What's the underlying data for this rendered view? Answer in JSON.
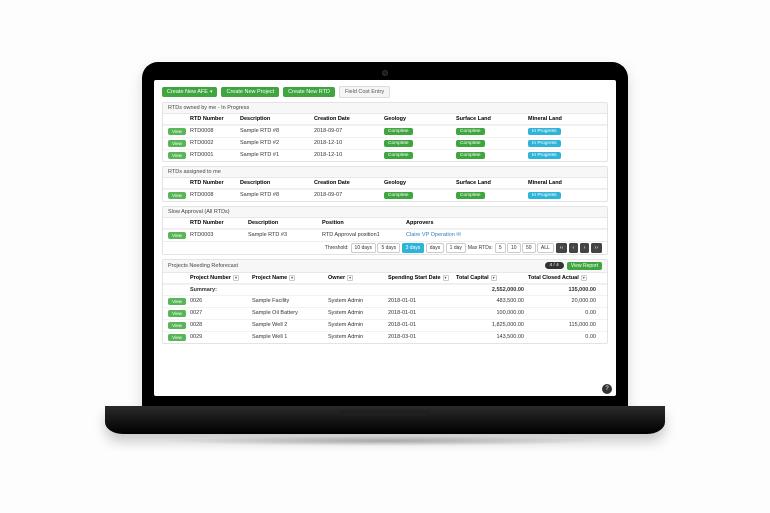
{
  "toolbar": {
    "create_afe": "Create New AFE",
    "create_project": "Create New Project",
    "create_rtd": "Create New RTD",
    "field_cost_entry": "Field Cost Entry"
  },
  "colors": {
    "green": "#3fa63f",
    "cyan": "#2fb4d9",
    "dark": "#333"
  },
  "labels": {
    "view": "View",
    "complete": "Complete",
    "in_progress": "In Progress"
  },
  "sections": {
    "owned": {
      "title": "RTDs owned by me - In Progress",
      "headers": [
        "RTD Number",
        "Description",
        "Creation Date",
        "Geology",
        "Surface Land",
        "Mineral Land"
      ],
      "rows": [
        {
          "num": "RTD0008",
          "desc": "Sample RTD #8",
          "date": "2018-09-07",
          "geo": "Complete",
          "surf": "Complete",
          "mineral": "In Progress"
        },
        {
          "num": "RTD0002",
          "desc": "Sample RTD #2",
          "date": "2018-12-10",
          "geo": "Complete",
          "surf": "Complete",
          "mineral": "In Progress"
        },
        {
          "num": "RTD0001",
          "desc": "Sample RTD #1",
          "date": "2018-12-10",
          "geo": "Complete",
          "surf": "Complete",
          "mineral": "In Progress"
        }
      ]
    },
    "assigned": {
      "title": "RTDs assigned to me",
      "headers": [
        "RTD Number",
        "Description",
        "Creation Date",
        "Geology",
        "Surface Land",
        "Mineral Land"
      ],
      "rows": [
        {
          "num": "RTD0008",
          "desc": "Sample RTD #8",
          "date": "2018-09-07",
          "geo": "Complete",
          "surf": "Complete",
          "mineral": "In Progress"
        }
      ]
    },
    "slow": {
      "title": "Slow Approval (All RTDs)",
      "headers": [
        "RTD Number",
        "Description",
        "Position",
        "Approvers"
      ],
      "rows": [
        {
          "num": "RTD0003",
          "desc": "Sample RTD #3",
          "pos": "RTD Approval position1",
          "appr": "Claire VP Operation"
        }
      ],
      "filters": {
        "threshold_label": "Threshold:",
        "opts": [
          "10 days",
          "5 days",
          "3 days",
          "days",
          "1 day"
        ],
        "selected": "3 days",
        "max_label": "Max RTDs:",
        "max_opts": [
          "5",
          "10",
          "50",
          "ALL"
        ],
        "chevrons": [
          "‹‹",
          "‹",
          "›",
          "››"
        ]
      }
    },
    "reforecast": {
      "title": "Projects Needing Reforecast",
      "badge": "4 / 4",
      "view_report": "View Report",
      "headers": [
        "Project Number",
        "Project Name",
        "Owner",
        "Spending Start Date",
        "Total Capital",
        "Total Closed Actual"
      ],
      "summary_label": "Summary:",
      "summary": {
        "capital": "2,552,000.00",
        "closed": "135,000.00"
      },
      "rows": [
        {
          "num": "0026",
          "name": "Sample Facility",
          "owner": "System Admin",
          "date": "2018-01-01",
          "capital": "483,500.00",
          "closed": "20,000.00"
        },
        {
          "num": "0027",
          "name": "Sample Oil Battery",
          "owner": "System Admin",
          "date": "2018-01-01",
          "capital": "100,000.00",
          "closed": "0.00"
        },
        {
          "num": "0028",
          "name": "Sample Well 2",
          "owner": "System Admin",
          "date": "2018-01-01",
          "capital": "1,825,000.00",
          "closed": "115,000.00"
        },
        {
          "num": "0029",
          "name": "Sample Well 1",
          "owner": "System Admin",
          "date": "2018-03-01",
          "capital": "143,500.00",
          "closed": "0.00"
        }
      ]
    }
  }
}
